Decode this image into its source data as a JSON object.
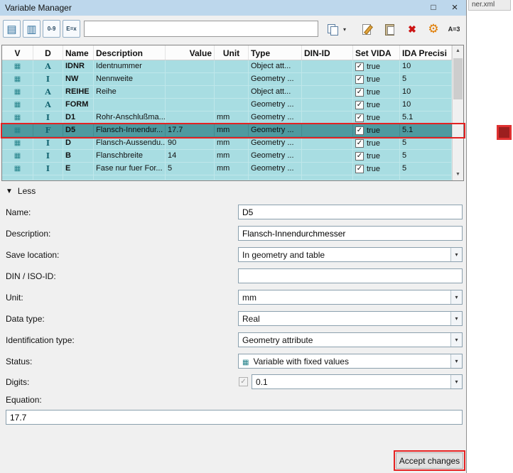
{
  "window": {
    "title": "Variable Manager"
  },
  "background": {
    "tab_label": "ner.xml"
  },
  "icons": {
    "variable_table": "▦",
    "check": "✓",
    "scroll_up": "▲",
    "scroll_down": "▼",
    "expander": "▼",
    "dropdown_arrow": "▾",
    "maximize": "□",
    "close": "×",
    "delete": "✖",
    "settings": "⚙",
    "list_view": "▤",
    "column_view": "▥",
    "numeric_filter": "0-9",
    "formula_filter": "E=x",
    "assign": "A=3"
  },
  "toolbar": {
    "filter_value": ""
  },
  "table": {
    "columns": [
      "V",
      "D",
      "Name",
      "Description",
      "Value",
      "Unit",
      "Type",
      "DIN-ID",
      "Set VIDA",
      "IDA Precisi"
    ],
    "rows": [
      {
        "d": "A",
        "name": "IDNR",
        "description": "Identnummer",
        "value": "",
        "unit": "",
        "type": "Object att...",
        "din_id": "",
        "set_vida": "true",
        "precision": "10"
      },
      {
        "d": "I",
        "name": "NW",
        "description": "Nennweite",
        "value": "",
        "unit": "",
        "type": "Geometry ...",
        "din_id": "",
        "set_vida": "true",
        "precision": "5"
      },
      {
        "d": "A",
        "name": "REIHE",
        "description": "Reihe",
        "value": "",
        "unit": "",
        "type": "Object att...",
        "din_id": "",
        "set_vida": "true",
        "precision": "10"
      },
      {
        "d": "A",
        "name": "FORM",
        "description": "",
        "value": "",
        "unit": "",
        "type": "Geometry ...",
        "din_id": "",
        "set_vida": "true",
        "precision": "10"
      },
      {
        "d": "I",
        "name": "D1",
        "description": "Rohr-Anschlußma...",
        "value": "",
        "unit": "mm",
        "type": "Geometry ...",
        "din_id": "",
        "set_vida": "true",
        "precision": "5.1"
      },
      {
        "d": "F",
        "name": "D5",
        "description": "Flansch-Innendur...",
        "value": "17.7",
        "unit": "mm",
        "type": "Geometry ...",
        "din_id": "",
        "set_vida": "true",
        "precision": "5.1",
        "selected": true
      },
      {
        "d": "I",
        "name": "D",
        "description": "Flansch-Aussendu...",
        "value": "90",
        "unit": "mm",
        "type": "Geometry ...",
        "din_id": "",
        "set_vida": "true",
        "precision": "5"
      },
      {
        "d": "I",
        "name": "B",
        "description": "Flanschbreite",
        "value": "14",
        "unit": "mm",
        "type": "Geometry ...",
        "din_id": "",
        "set_vida": "true",
        "precision": "5"
      },
      {
        "d": "I",
        "name": "E",
        "description": "Fase nur fuer For...",
        "value": "5",
        "unit": "mm",
        "type": "Geometry ...",
        "din_id": "",
        "set_vida": "true",
        "precision": "5"
      },
      {
        "d": "",
        "name": "",
        "description": "",
        "value": "",
        "unit": "",
        "type": "",
        "din_id": "",
        "set_vida": "",
        "precision": "",
        "partial": true
      }
    ]
  },
  "expander_label": "Less",
  "form": {
    "name": {
      "label": "Name:",
      "value": "D5"
    },
    "description": {
      "label": "Description:",
      "value": "Flansch-Innendurchmesser"
    },
    "save_location": {
      "label": "Save location:",
      "value": "In geometry and table"
    },
    "din_iso_id": {
      "label": "DIN / ISO-ID:",
      "value": ""
    },
    "unit": {
      "label": "Unit:",
      "value": "mm"
    },
    "data_type": {
      "label": "Data type:",
      "value": "Real"
    },
    "identification_type": {
      "label": "Identification type:",
      "value": "Geometry attribute"
    },
    "status": {
      "label": "Status:",
      "value": "Variable with fixed values"
    },
    "digits": {
      "label": "Digits:",
      "value": "0.1"
    },
    "equation": {
      "label": "Equation:",
      "value": "17.7"
    }
  },
  "accept_button_label": "Accept changes"
}
